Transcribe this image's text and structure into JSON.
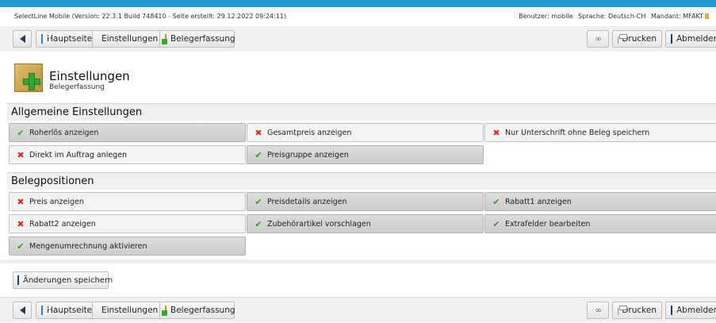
{
  "info": {
    "app_info": "SelectLine Mobile (Version: 22.3.1 Build 748410 - Seite erstellt: 29.12.2022 09:24:11)",
    "user": "Benutzer: mobile",
    "language": "Sprache: Deutsch-CH",
    "mandant": "Mandant: MFAKT"
  },
  "toolbar": {
    "home_label": "Hauptseite",
    "settings_label": "Einstellungen",
    "beleg_label": "Belegerfassung",
    "print_label": "Drucken",
    "logout_label": "Abmelden"
  },
  "header": {
    "title": "Einstellungen",
    "subtitle": "Belegerfassung"
  },
  "sections": [
    {
      "title": "Allgemeine Einstellungen",
      "options": [
        {
          "label": "Roherlös anzeigen",
          "enabled": true
        },
        {
          "label": "Gesamtpreis anzeigen",
          "enabled": false
        },
        {
          "label": "Nur Unterschrift ohne Beleg speichern",
          "enabled": false
        },
        {
          "label": "Direkt im Auftrag anlegen",
          "enabled": false
        },
        {
          "label": "Preisgruppe anzeigen",
          "enabled": true
        }
      ]
    },
    {
      "title": "Belegpositionen",
      "options": [
        {
          "label": "Preis anzeigen",
          "enabled": false
        },
        {
          "label": "Preisdetails anzeigen",
          "enabled": true
        },
        {
          "label": "Rabatt1 anzeigen",
          "enabled": true
        },
        {
          "label": "Rabatt2 anzeigen",
          "enabled": false
        },
        {
          "label": "Zubehörartikel vorschlagen",
          "enabled": true
        },
        {
          "label": "Extrafelder bearbeiten",
          "enabled": true
        },
        {
          "label": "Mengenumrechnung aktivieren",
          "enabled": true
        }
      ]
    }
  ],
  "save_label": "Änderungen speichern",
  "colors": {
    "accent": "#1f9ad6",
    "check": "#3c9a23",
    "cross": "#d33224"
  },
  "icons": {
    "enabled": "check-icon",
    "disabled": "cross-icon"
  }
}
